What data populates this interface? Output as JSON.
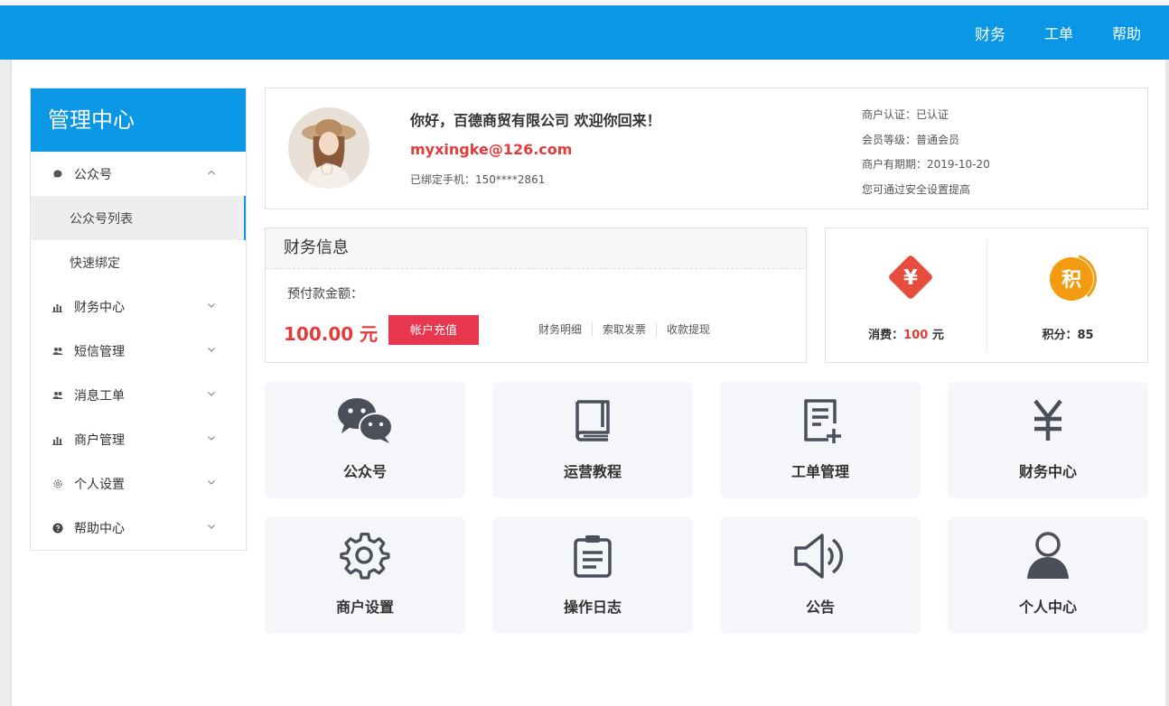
{
  "topnav": [
    "财务",
    "工单",
    "帮助"
  ],
  "sidebar": {
    "title": "管理中心",
    "items": [
      {
        "label": "公众号",
        "icon": "chat-bubble-icon",
        "expanded": true,
        "children": [
          {
            "label": "公众号列表",
            "active": true
          },
          {
            "label": "快速绑定"
          }
        ]
      },
      {
        "label": "财务中心",
        "icon": "bar-chart-icon"
      },
      {
        "label": "短信管理",
        "icon": "users-icon"
      },
      {
        "label": "消息工单",
        "icon": "users-icon"
      },
      {
        "label": "商户管理",
        "icon": "bar-chart-icon"
      },
      {
        "label": "个人设置",
        "icon": "gear-icon"
      },
      {
        "label": "帮助中心",
        "icon": "question-icon"
      }
    ]
  },
  "profile": {
    "greeting": "你好，百德商贸有限公司 欢迎你回来！",
    "email": "myxingke@126.com",
    "phone": "已绑定手机：150****2861",
    "info": [
      "商户认证：已认证",
      "会员等级：普通会员",
      "商户有期期：2019-10-20",
      "您可通过安全设置提高"
    ]
  },
  "finance": {
    "title": "财务信息",
    "prepay_label": "预付款金额：",
    "amount": "100.00 元",
    "recharge_button": "帐户充值",
    "links": [
      "财务明细",
      "索取发票",
      "收款提现"
    ]
  },
  "stats": {
    "consume": {
      "label": "消费：",
      "value": "100",
      "unit": " 元",
      "icon_text": "¥"
    },
    "points": {
      "label": "积分：",
      "value": "85",
      "icon_text": "积"
    }
  },
  "tiles": [
    {
      "label": "公众号",
      "icon": "wechat-icon"
    },
    {
      "label": "运营教程",
      "icon": "book-icon"
    },
    {
      "label": "工单管理",
      "icon": "ticket-icon"
    },
    {
      "label": "财务中心",
      "icon": "yen-icon"
    },
    {
      "label": "商户设置",
      "icon": "gear-icon"
    },
    {
      "label": "操作日志",
      "icon": "clipboard-icon"
    },
    {
      "label": "公告",
      "icon": "speaker-icon"
    },
    {
      "label": "个人中心",
      "icon": "user-icon"
    }
  ],
  "colors": {
    "primary": "#0997e6",
    "danger": "#e23b3b",
    "button": "#e8384f",
    "points": "#f39c12",
    "icon": "#4a4f5a"
  }
}
